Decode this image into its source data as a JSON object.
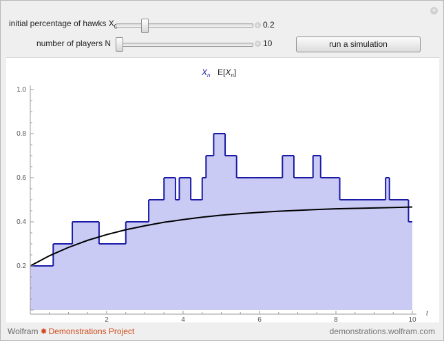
{
  "controls": {
    "hawks": {
      "label": "initial percentage of hawks X",
      "label_sub": "0",
      "value": "0.2",
      "slider_fraction": 0.2
    },
    "players": {
      "label": "number of players N",
      "value": "10",
      "slider_fraction": 0.0
    },
    "button_label": "run a simulation"
  },
  "footer": {
    "brand_wolfram": "Wolfram",
    "brand_demos": "Demonstrations Project",
    "site": "demonstrations.wolfram.com"
  },
  "chart_data": {
    "type": "line",
    "legend": {
      "series1_label": "X",
      "series1_sub": "n",
      "series2_label_pre": "E[",
      "series2_label_var": "X",
      "series2_label_sub": "n",
      "series2_label_post": "]"
    },
    "xlabel": "t",
    "xlim": [
      0,
      10
    ],
    "ylim": [
      0,
      1.0
    ],
    "x_ticks": [
      "2",
      "4",
      "6",
      "8",
      "10"
    ],
    "x_tick_values": [
      2,
      4,
      6,
      8,
      10
    ],
    "y_ticks": [
      "0.2",
      "0.4",
      "0.6",
      "0.8",
      "1.0"
    ],
    "y_tick_values": [
      0.2,
      0.4,
      0.6,
      0.8,
      1.0
    ],
    "colors": {
      "step": "#1a1aa6",
      "fill": "#c9cbf5",
      "expected": "#000000"
    },
    "series": [
      {
        "name": "X_n",
        "style": "step",
        "x": [
          0,
          0.6,
          1.1,
          1.8,
          2.5,
          3.1,
          3.5,
          3.8,
          3.9,
          4.2,
          4.5,
          4.6,
          4.8,
          5.1,
          5.4,
          5.9,
          6.6,
          6.9,
          7.4,
          7.6,
          8.1,
          8.6,
          9.3,
          9.4,
          9.9
        ],
        "values": [
          0.2,
          0.3,
          0.4,
          0.3,
          0.4,
          0.5,
          0.6,
          0.5,
          0.6,
          0.5,
          0.6,
          0.7,
          0.8,
          0.7,
          0.6,
          0.6,
          0.7,
          0.6,
          0.7,
          0.6,
          0.5,
          0.5,
          0.6,
          0.5,
          0.4
        ],
        "x_end": 10
      },
      {
        "name": "E[X_n]",
        "style": "curve",
        "x": [
          0,
          0.5,
          1,
          1.5,
          2,
          2.5,
          3,
          3.5,
          4,
          4.5,
          5,
          5.5,
          6,
          6.5,
          7,
          7.5,
          8,
          8.5,
          9,
          9.5,
          10
        ],
        "values": [
          0.2,
          0.246,
          0.284,
          0.316,
          0.342,
          0.364,
          0.382,
          0.398,
          0.41,
          0.421,
          0.43,
          0.437,
          0.443,
          0.448,
          0.452,
          0.456,
          0.459,
          0.461,
          0.463,
          0.465,
          0.467
        ]
      }
    ]
  }
}
